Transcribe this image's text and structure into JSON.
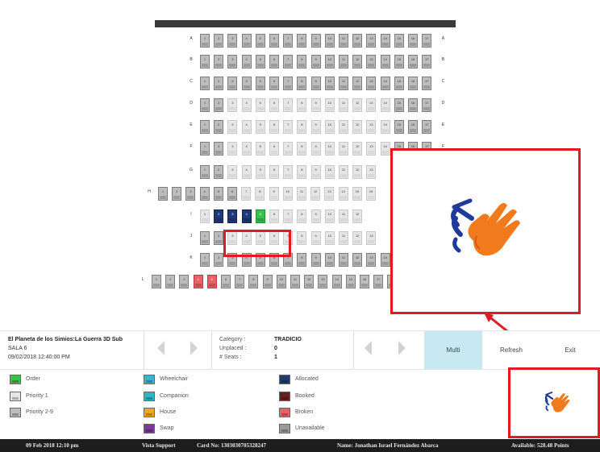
{
  "seatmap": {
    "rows": [
      {
        "label": "A",
        "seats": [
          "1",
          "2",
          "3",
          "4",
          "5",
          "6",
          "7",
          "8",
          "9",
          "10",
          "11",
          "12",
          "13",
          "14",
          "15",
          "16",
          "17"
        ]
      },
      {
        "label": "B",
        "seats": [
          "1",
          "2",
          "3",
          "4",
          "5",
          "6",
          "7",
          "8",
          "9",
          "10",
          "11",
          "12",
          "13",
          "14",
          "15",
          "16",
          "17"
        ]
      },
      {
        "label": "C",
        "seats": [
          "1",
          "2",
          "3",
          "4",
          "5",
          "6",
          "7",
          "8",
          "9",
          "10",
          "11",
          "12",
          "13",
          "14",
          "15",
          "16",
          "17"
        ]
      },
      {
        "label": "D",
        "seats": [
          "1",
          "2",
          "3",
          "4",
          "5",
          "6",
          "7",
          "8",
          "9",
          "10",
          "11",
          "12",
          "13",
          "14",
          "15",
          "16",
          "17"
        ]
      },
      {
        "label": "E",
        "seats": [
          "1",
          "2",
          "3",
          "4",
          "5",
          "6",
          "7",
          "8",
          "9",
          "10",
          "11",
          "12",
          "13",
          "14",
          "15",
          "16",
          "17"
        ]
      },
      {
        "label": "F",
        "seats": [
          "1",
          "2",
          "3",
          "4",
          "5",
          "6",
          "7",
          "8",
          "9",
          "10",
          "11",
          "12",
          "13",
          "14",
          "15",
          "16",
          "17"
        ]
      },
      {
        "label": "G",
        "seats": [
          "1",
          "2",
          "3",
          "4",
          "5",
          "6",
          "7",
          "8",
          "9",
          "10",
          "11",
          "12",
          "13"
        ]
      },
      {
        "label": "H",
        "seats": [
          "1",
          "2",
          "3",
          "4",
          "5",
          "6",
          "7",
          "8",
          "9",
          "10",
          "11",
          "12",
          "13",
          "14",
          "15",
          "16"
        ]
      },
      {
        "label": "I",
        "seats": [
          "1",
          "2",
          "3",
          "4",
          "5",
          "6",
          "7",
          "8",
          "9",
          "10",
          "11",
          "12"
        ]
      },
      {
        "label": "J",
        "seats": [
          "1",
          "2",
          "3",
          "4",
          "5",
          "6",
          "7",
          "8",
          "9",
          "10",
          "11",
          "12",
          "13"
        ]
      },
      {
        "label": "K",
        "seats": [
          "1",
          "2",
          "3",
          "4",
          "5",
          "6",
          "7",
          "8",
          "9",
          "10",
          "11",
          "12",
          "13",
          "14",
          "15",
          "16"
        ]
      },
      {
        "label": "L",
        "seats": [
          "1",
          "2",
          "3",
          "4",
          "5",
          "6",
          "7",
          "8",
          "9",
          "10",
          "11",
          "12",
          "13",
          "14",
          "15",
          "16",
          "17",
          "18",
          "19",
          "20",
          "21",
          "22"
        ]
      }
    ]
  },
  "movie": {
    "title": "El Planeta de los Simios:La Guerra 3D Sub",
    "room": "SALA 6",
    "datetime": "09/02/2018 12:40:00 PM"
  },
  "category": {
    "category_label": "Category :",
    "category_value": "TRADICIO",
    "unplaced_label": "Unplaced :",
    "unplaced_value": "0",
    "seats_label": "# Seats :",
    "seats_value": "1"
  },
  "actions": {
    "multi": "Multi",
    "refresh": "Refresh",
    "exit": "Exit"
  },
  "legend": [
    {
      "label": "Order",
      "color": "#39c24a"
    },
    {
      "label": "Priority 1",
      "color": "#e6e6e6"
    },
    {
      "label": "Priority 2-9",
      "color": "#bdbdbd"
    },
    {
      "label": "Wheelchair",
      "color": "#3bb3d6"
    },
    {
      "label": "Companion",
      "color": "#2bb8c4"
    },
    {
      "label": "House",
      "color": "#f2a81d"
    },
    {
      "label": "Swap",
      "color": "#7a3b97"
    },
    {
      "label": "Allocated",
      "color": "#1f3a78"
    },
    {
      "label": "Booked",
      "color": "#6b1f1f"
    },
    {
      "label": "Broken",
      "color": "#e8606a"
    },
    {
      "label": "Unavailable",
      "color": "#9a9a9a"
    }
  ],
  "status_bar": {
    "date": "09 Feb 2018 12:10 pm",
    "support": "Vista Support",
    "card": "Card No: 1303030705328247",
    "name": "Name: Jonathan Israel Fernández Abarca",
    "available": "Available: 528.48 Points"
  },
  "colors": {
    "highlight": "#e01b24",
    "multi_button_bg": "#c9e9f2",
    "status_bar_bg": "#1d1d1d"
  },
  "icons": {
    "zoom_popup": "clapping-hands-icon",
    "zoom_small": "clapping-hands-icon",
    "nav_prev": "left-arrow-icon",
    "nav_next": "right-arrow-icon"
  }
}
